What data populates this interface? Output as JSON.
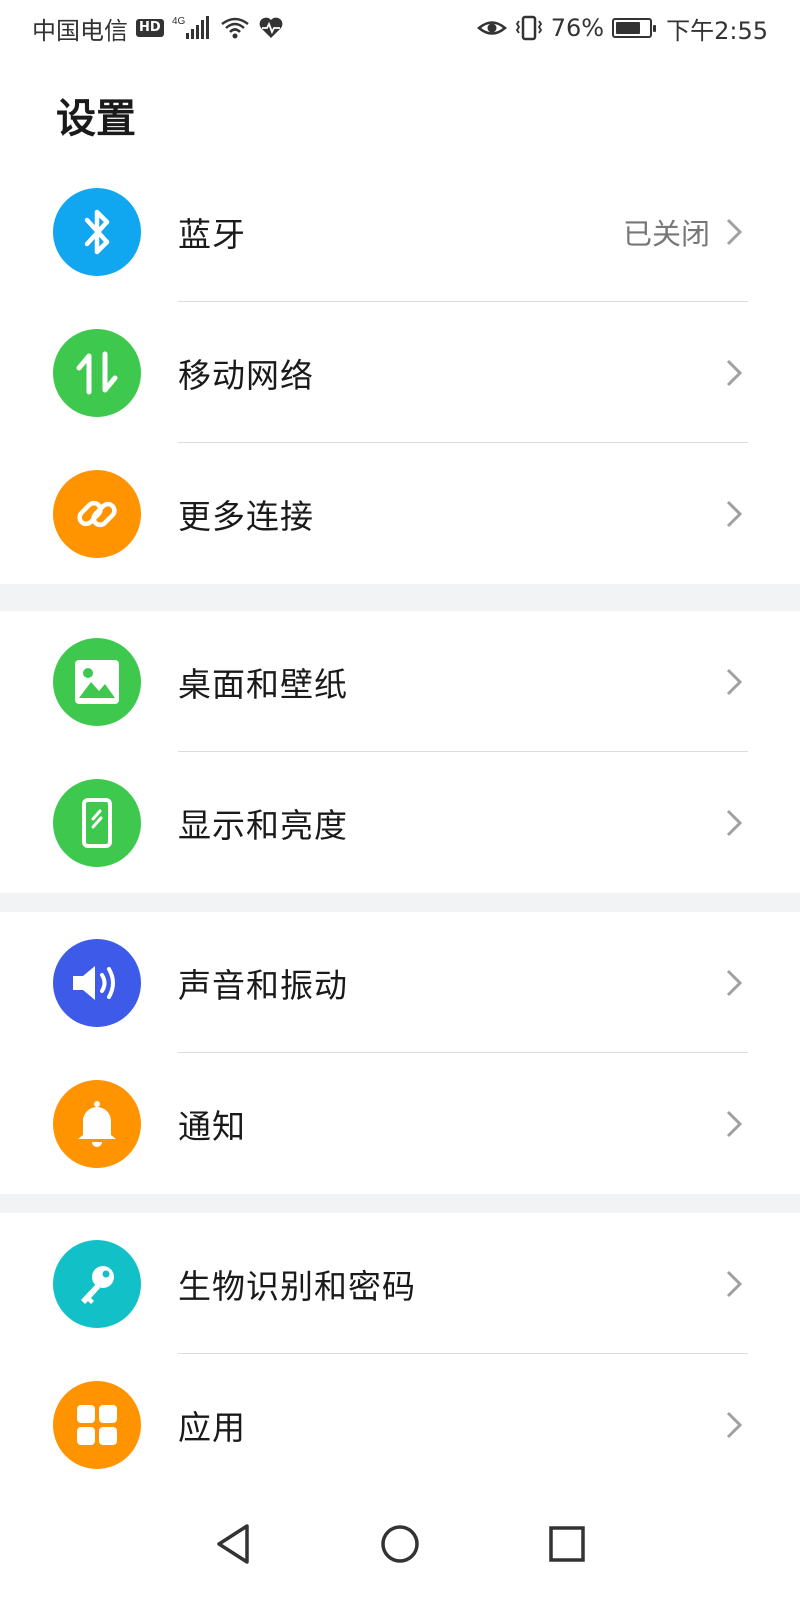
{
  "status_bar": {
    "carrier": "中国电信",
    "hd_badge": "HD",
    "network_type": "4G",
    "battery_percent_text": "76%",
    "battery_level": 0.76,
    "time": "下午2:55",
    "icons": [
      "hd-icon",
      "signal-icon",
      "wifi-icon",
      "heart-rate-icon",
      "eye-comfort-icon",
      "vibrate-icon",
      "battery-icon"
    ]
  },
  "header": {
    "title": "设置"
  },
  "colors": {
    "bluetooth": "#10a6f0",
    "mobile_network": "#3ec84e",
    "more_connections": "#ff9300",
    "home_wallpaper": "#3ec84e",
    "display": "#3ec84e",
    "sound": "#3e5ae8",
    "notifications": "#ff9300",
    "biometrics": "#12c1c8",
    "apps": "#ff9300"
  },
  "settings": {
    "groups": [
      {
        "items": [
          {
            "label": "蓝牙",
            "value": "已关闭",
            "icon": "bluetooth-icon"
          },
          {
            "label": "移动网络",
            "value": "",
            "icon": "mobile-data-icon"
          },
          {
            "label": "更多连接",
            "value": "",
            "icon": "link-icon"
          }
        ]
      },
      {
        "items": [
          {
            "label": "桌面和壁纸",
            "value": "",
            "icon": "wallpaper-icon"
          },
          {
            "label": "显示和亮度",
            "value": "",
            "icon": "display-icon"
          }
        ]
      },
      {
        "items": [
          {
            "label": "声音和振动",
            "value": "",
            "icon": "volume-icon"
          },
          {
            "label": "通知",
            "value": "",
            "icon": "bell-icon"
          }
        ]
      },
      {
        "items": [
          {
            "label": "生物识别和密码",
            "value": "",
            "icon": "key-icon"
          },
          {
            "label": "应用",
            "value": "",
            "icon": "apps-grid-icon"
          }
        ]
      }
    ]
  },
  "nav_bar": {
    "buttons": [
      "back-icon",
      "home-icon",
      "recents-icon"
    ]
  }
}
